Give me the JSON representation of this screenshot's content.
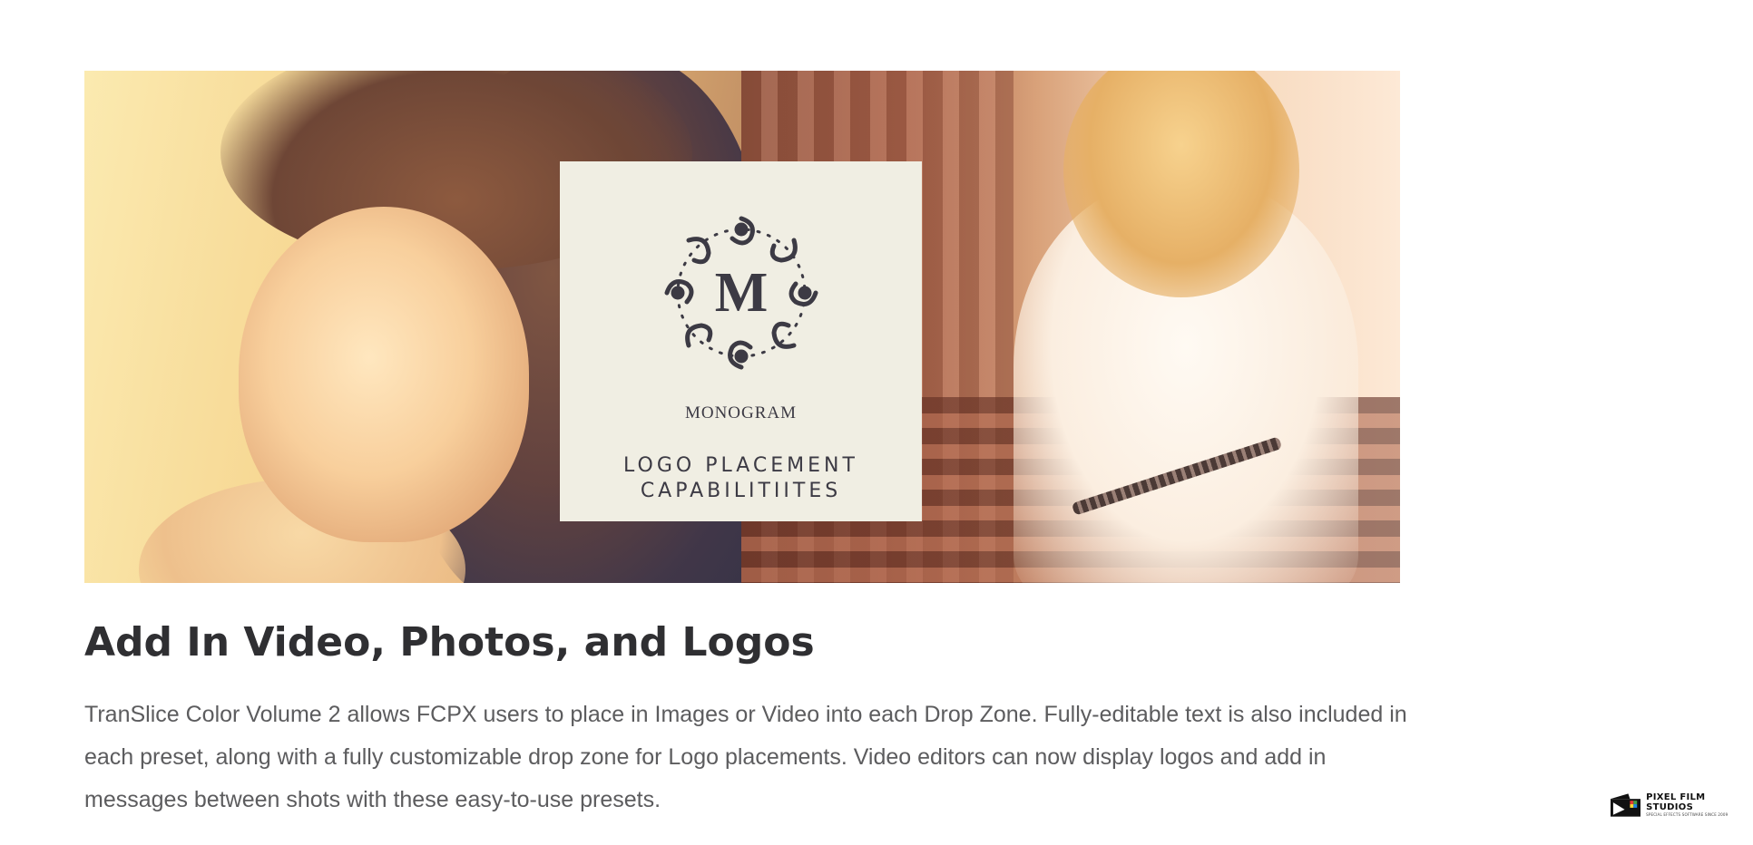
{
  "hero": {
    "card": {
      "emblem_letter": "M",
      "monogram_name": "MONOGRAM",
      "caption_line1": "LOGO PLACEMENT",
      "caption_line2": "CAPABILITIITES"
    }
  },
  "section": {
    "heading": "Add In Video, Photos, and Logos",
    "description": "TranSlice Color Volume 2 allows FCPX users to place in Images or Video into each Drop Zone. Fully-editable text is also included in each preset, along with a fully customizable drop zone for Logo placements. Video editors can now display logos and add in messages between shots with these easy-to-use presets."
  },
  "badge": {
    "name": "PIXEL FILM STUDIOS",
    "tagline": "SPECIAL EFFECTS SOFTWARE SINCE 2009",
    "icon": "film-clapper-icon"
  },
  "colors": {
    "heading": "#2f2f32",
    "body_text": "#5c5c5e",
    "card_bg": "#f0eee3",
    "card_ink": "#3c3a44"
  }
}
